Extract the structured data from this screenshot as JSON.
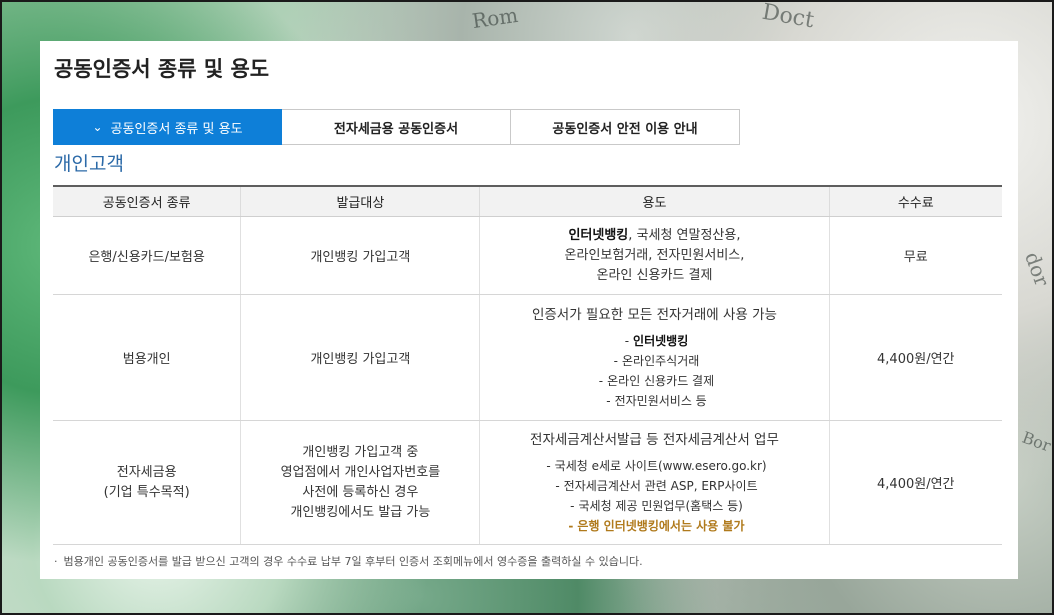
{
  "page_title": "공동인증서 종류 및 용도",
  "tabs": [
    {
      "label": "공동인증서 종류 및 용도",
      "active": true,
      "icon": "chevron-down-icon"
    },
    {
      "label": "전자세금용 공동인증서",
      "active": false
    },
    {
      "label": "공동인증서 안전 이용 안내",
      "active": false
    }
  ],
  "section_title": "개인고객",
  "table": {
    "headers": [
      "공동인증서 종류",
      "발급대상",
      "용도",
      "수수료"
    ],
    "rows": [
      {
        "type": "은행/신용카드/보험용",
        "target": "개인뱅킹 가입고객",
        "usage_first_bold": "인터넷뱅킹",
        "usage_first_rest": ", 국세청 연말정산용,",
        "usage_lines": [
          "온라인보험거래, 전자민원서비스,",
          "온라인 신용카드 결제"
        ],
        "fee": "무료"
      },
      {
        "type": "범용개인",
        "target": "개인뱅킹 가입고객",
        "usage_lead": "인증서가 필요한 모든 전자거래에 사용 가능",
        "usage_bullets": [
          "인터넷뱅킹",
          "온라인주식거래",
          "온라인 신용카드 결제",
          "전자민원서비스 등"
        ],
        "fee": "4,400원/연간"
      },
      {
        "type_line1": "전자세금용",
        "type_line2": "(기업 특수목적)",
        "target_lines": [
          "개인뱅킹 가입고객 중",
          "영업점에서 개인사업자번호를",
          "사전에 등록하신 경우",
          "개인뱅킹에서도 발급 가능"
        ],
        "usage_lead": "전자세금계산서발급 등 전자세금계산서 업무",
        "usage_bullets": [
          "국세청 e세로 사이트(www.esero.go.kr)",
          "전자세금계산서 관련 ASP, ERP사이트",
          "국세청 제공 민원업무(홈택스 등)"
        ],
        "usage_warning": "은행 인터넷뱅킹에서는 사용 불가",
        "fee": "4,400원/연간"
      }
    ]
  },
  "footnote": "범용개인 공동인증서를 발급 받으신 고객의 경우 수수료 납부 7일 후부터 인증서 조회메뉴에서 영수증을 출력하실 수 있습니다.",
  "bullet_dash": "-",
  "footnote_dot": "·",
  "colors": {
    "active_tab": "#0e7fd8",
    "section_title": "#2c6aa8",
    "warning": "#b07a1c"
  }
}
